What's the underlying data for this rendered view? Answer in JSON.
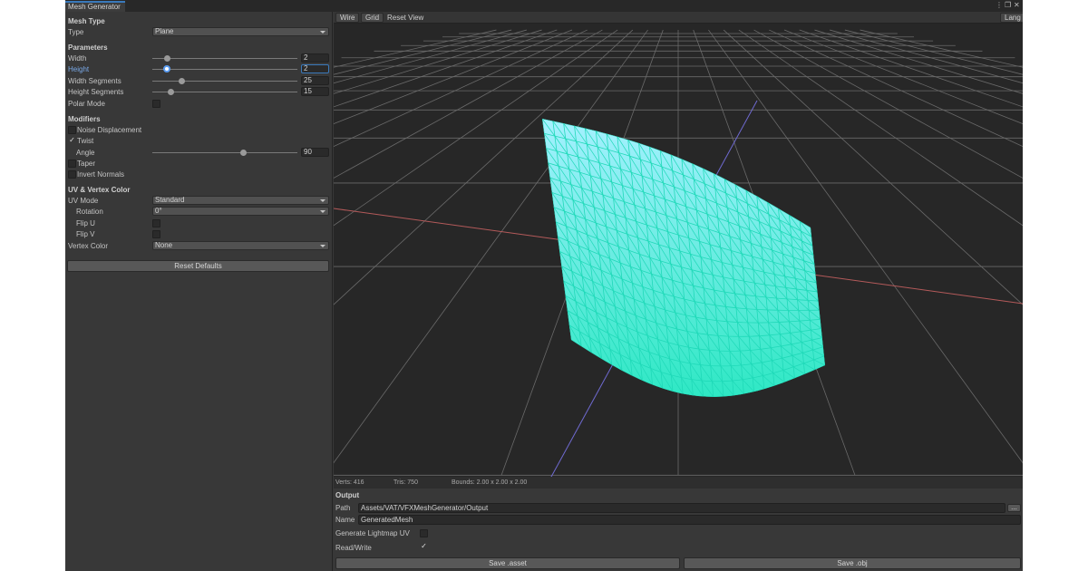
{
  "window": {
    "tab_title": "Mesh Generator",
    "menu_glyph": "⋮",
    "maximize_glyph": "❐",
    "close_glyph": "✕"
  },
  "inspector": {
    "mesh_type_header": "Mesh Type",
    "type_label": "Type",
    "type_value": "Plane",
    "parameters_header": "Parameters",
    "width_label": "Width",
    "width_value": "2",
    "width_fraction": 0.1,
    "height_label": "Height",
    "height_value": "2",
    "height_fraction": 0.1,
    "width_segments_label": "Width Segments",
    "width_segments_value": "25",
    "width_segments_fraction": 0.2,
    "height_segments_label": "Height Segments",
    "height_segments_value": "15",
    "height_segments_fraction": 0.13,
    "polar_mode_label": "Polar Mode",
    "polar_mode_checked": false,
    "modifiers_header": "Modifiers",
    "noise_label": "Noise Displacement",
    "noise_checked": false,
    "twist_label": "Twist",
    "twist_checked": true,
    "angle_label": "Angle",
    "angle_value": "90",
    "angle_fraction": 0.63,
    "taper_label": "Taper",
    "taper_checked": false,
    "invert_normals_label": "Invert Normals",
    "invert_normals_checked": false,
    "uv_header": "UV & Vertex Color",
    "uv_mode_label": "UV Mode",
    "uv_mode_value": "Standard",
    "rotation_label": "Rotation",
    "rotation_value": "0°",
    "flip_u_label": "Flip U",
    "flip_u_checked": false,
    "flip_v_label": "Flip V",
    "flip_v_checked": false,
    "vertex_color_label": "Vertex Color",
    "vertex_color_value": "None",
    "reset_defaults_label": "Reset Defaults",
    "check_glyph": "✓"
  },
  "viewport": {
    "wire_label": "Wire",
    "grid_label": "Grid",
    "reset_view_label": "Reset View",
    "lang_label": "Lang",
    "wire_on": true,
    "grid_on": true,
    "mesh_color_top": "#a6f0ff",
    "mesh_color_bottom": "#2ee8c4",
    "wire_color": "#1fd9b8"
  },
  "status": {
    "verts": "Verts: 416",
    "tris": "Tris: 750",
    "bounds": "Bounds: 2.00 x 2.00 x 2.00"
  },
  "output": {
    "header": "Output",
    "path_label": "Path",
    "path_value": "Assets/VAT/VFXMeshGenerator/Output",
    "browse_label": "...",
    "name_label": "Name",
    "name_value": "GeneratedMesh",
    "lightmap_label": "Generate Lightmap UV",
    "lightmap_checked": false,
    "readwrite_label": "Read/Write",
    "readwrite_checked": true,
    "save_asset_label": "Save .asset",
    "save_obj_label": "Save .obj"
  }
}
